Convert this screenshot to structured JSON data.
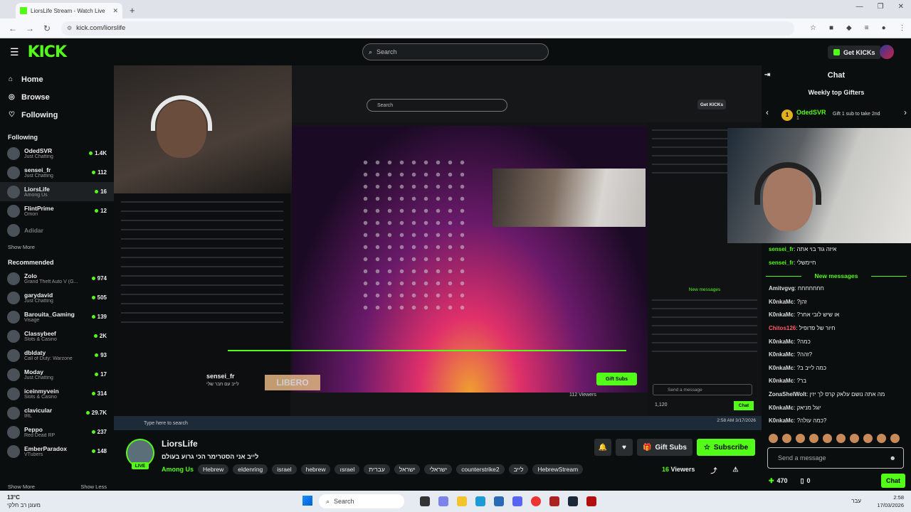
{
  "browser": {
    "tab_title": "LiorsLife Stream - Watch Live",
    "url": "kick.com/liorslife"
  },
  "header": {
    "logo": "KICK",
    "search_placeholder": "Search",
    "get_kicks": "Get KICKs"
  },
  "sidebar": {
    "nav": [
      {
        "label": "Home",
        "icon": "home-icon"
      },
      {
        "label": "Browse",
        "icon": "compass-icon"
      },
      {
        "label": "Following",
        "icon": "heart-icon"
      }
    ],
    "following_title": "Following",
    "following": [
      {
        "name": "OdedSVR",
        "category": "Just Chatting",
        "viewers": "1.4K"
      },
      {
        "name": "sensei_fr",
        "category": "Just Chatting",
        "viewers": "112"
      },
      {
        "name": "LiorsLife",
        "category": "Among Us",
        "viewers": "16"
      },
      {
        "name": "FlintPrime",
        "category": "Omori",
        "viewers": "12"
      },
      {
        "name": "Adidar",
        "category": "",
        "viewers": ""
      }
    ],
    "show_more": "Show More",
    "recommended_title": "Recommended",
    "recommended": [
      {
        "name": "Zolo",
        "category": "Grand Theft Auto V (G...",
        "viewers": "974"
      },
      {
        "name": "garydavid",
        "category": "Just Chatting",
        "viewers": "505"
      },
      {
        "name": "Barouita_Gaming",
        "category": "Visage",
        "viewers": "139"
      },
      {
        "name": "Classybeef",
        "category": "Slots & Casino",
        "viewers": "2K"
      },
      {
        "name": "dbldaty",
        "category": "Call of Duty: Warzone",
        "viewers": "93"
      },
      {
        "name": "Moday",
        "category": "Just Chatting",
        "viewers": "17"
      },
      {
        "name": "iceinmyvein",
        "category": "Slots & Casino",
        "viewers": "314"
      },
      {
        "name": "clavicular",
        "category": "IRL",
        "viewers": "29.7K"
      },
      {
        "name": "Peppo",
        "category": "Red Dead RP",
        "viewers": "237"
      },
      {
        "name": "EmberParadox",
        "category": "VTubers",
        "viewers": "148"
      }
    ],
    "show_more_2": "Show More",
    "show_less": "Show Less"
  },
  "video": {
    "inner_search": "Search",
    "inner_get_kicks": "Get KICKs",
    "inner_streamer": "sensei_fr",
    "inner_title": "לייב עם חבר שלי",
    "inner_gift": "Gift Subs",
    "inner_viewers": "112 Viewers",
    "inner_send": "Send a message",
    "inner_chat": "Chat",
    "inner_kicks": "1,120",
    "inner_new_messages": "New messages",
    "inner_overlay": "LIBERO",
    "inner_taskbar_search": "Type here to search",
    "inner_clock": "2:58 AM\n3/17/2026"
  },
  "stream_info": {
    "streamer": "LiorsLife",
    "title": "לייב אני הסטרימר הכי גרוע בעולם",
    "category": "Among Us",
    "tags": [
      "Hebrew",
      "eldenring",
      "israel",
      "hebrew",
      "ısrael",
      "עברית",
      "ישראל",
      "ישראלי",
      "counterstrike2",
      "לייב",
      "HebrewStream"
    ],
    "live": "LIVE",
    "gift_subs": "Gift Subs",
    "subscribe": "Subscribe",
    "viewers_num": "16",
    "viewers_label": "Viewers"
  },
  "chat": {
    "title": "Chat",
    "gifters_title": "Weekly top Gifters",
    "top_gifter": "OdedSVR",
    "top_gifter_count": "1",
    "top_gifter_rank": "1",
    "gift_prompt": "Gift 1 sub to take 2nd",
    "new_messages": "New messages",
    "messages_before": [
      {
        "user": "sensei_fr",
        "text": "איזה גוד בוי אתה",
        "color": "g"
      },
      {
        "user": "sensei_fr",
        "text": "חיימשלי",
        "color": "g"
      }
    ],
    "messages_after": [
      {
        "user": "Amitvgvg",
        "text": "חחחחחחח",
        "color": ""
      },
      {
        "user": "K0nkaMc",
        "text": "?זהן",
        "color": ""
      },
      {
        "user": "K0nkaMc",
        "text": "?או שיש לובי אחר",
        "color": ""
      },
      {
        "user": "Chitos126",
        "text": "חיור של פדופיל",
        "color": "r"
      },
      {
        "user": "K0nkaMc",
        "text": "?כמה",
        "color": ""
      },
      {
        "user": "K0nkaMc",
        "text": "?זהה?",
        "color": ""
      },
      {
        "user": "K0nkaMc",
        "text": "?כמה לייב ב",
        "color": ""
      },
      {
        "user": "K0nkaMc",
        "text": "?בר",
        "color": ""
      },
      {
        "user": "ZonaShelWolt",
        "text": "מה אתה נושם עלאק קרס לך יזין",
        "color": ""
      },
      {
        "user": "K0nkaMc",
        "text": "יוגל מניאק",
        "color": ""
      },
      {
        "user": "K0nkaMc",
        "text": "?כמה עולה?",
        "color": ""
      }
    ],
    "send_placeholder": "Send a message",
    "kicks_balance": "470",
    "second_count": "0",
    "chat_button": "Chat"
  },
  "taskbar": {
    "temp": "13°C",
    "weather": "מעונן רב חלקי",
    "search": "Search",
    "lang": "עבר",
    "time": "2:58",
    "date": "17/03/2026"
  },
  "colors": {
    "accent": "#53fc18",
    "background": "#0b0e0f"
  }
}
